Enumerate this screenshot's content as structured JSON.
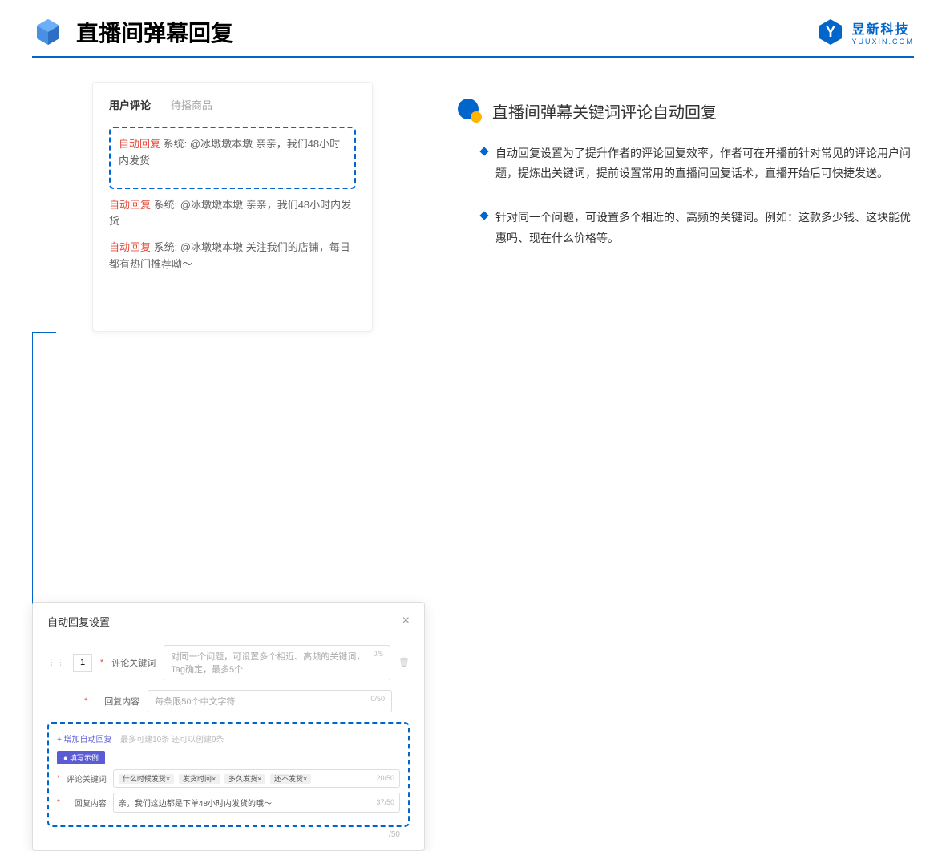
{
  "header": {
    "title": "直播间弹幕回复",
    "logo_cn": "昱新科技",
    "logo_en": "YUUXIN.COM"
  },
  "card1": {
    "tab_active": "用户评论",
    "tab_inactive": "待播商品",
    "auto_reply_label": "自动回复",
    "system_label": "系统:",
    "comment1": "@冰墩墩本墩 亲亲，我们48小时内发货",
    "comment2": "@冰墩墩本墩 亲亲，我们48小时内发货",
    "comment3": "@冰墩墩本墩 关注我们的店铺，每日都有热门推荐呦～"
  },
  "card2": {
    "title": "自动回复设置",
    "index": "1",
    "keyword_label": "评论关键词",
    "keyword_placeholder": "对同一个问题，可设置多个相近、高频的关键词，Tag确定，最多5个",
    "keyword_counter": "0/5",
    "content_label": "回复内容",
    "content_placeholder": "每条限50个中文字符",
    "content_counter": "0/50",
    "add_link": "+ 增加自动回复",
    "add_hint": "最多可建10条 还可以创建9条",
    "example_badge": "● 填写示例",
    "ex_kw_label": "评论关键词",
    "tag1": "什么时候发货×",
    "tag2": "发货时间×",
    "tag3": "多久发货×",
    "tag4": "还不发货×",
    "ex_kw_counter": "20/50",
    "ex_content_label": "回复内容",
    "ex_content_value": "亲，我们这边都是下单48小时内发货的哦～",
    "ex_content_counter": "37/50",
    "outside_counter": "/50"
  },
  "right": {
    "section_title": "直播间弹幕关键词评论自动回复",
    "bullet1": "自动回复设置为了提升作者的评论回复效率，作者可在开播前针对常见的评论用户问题，提炼出关键词，提前设置常用的直播间回复话术，直播开始后可快捷发送。",
    "bullet2": "针对同一个问题，可设置多个相近的、高频的关键词。例如：这款多少钱、这块能优惠吗、现在什么价格等。"
  }
}
